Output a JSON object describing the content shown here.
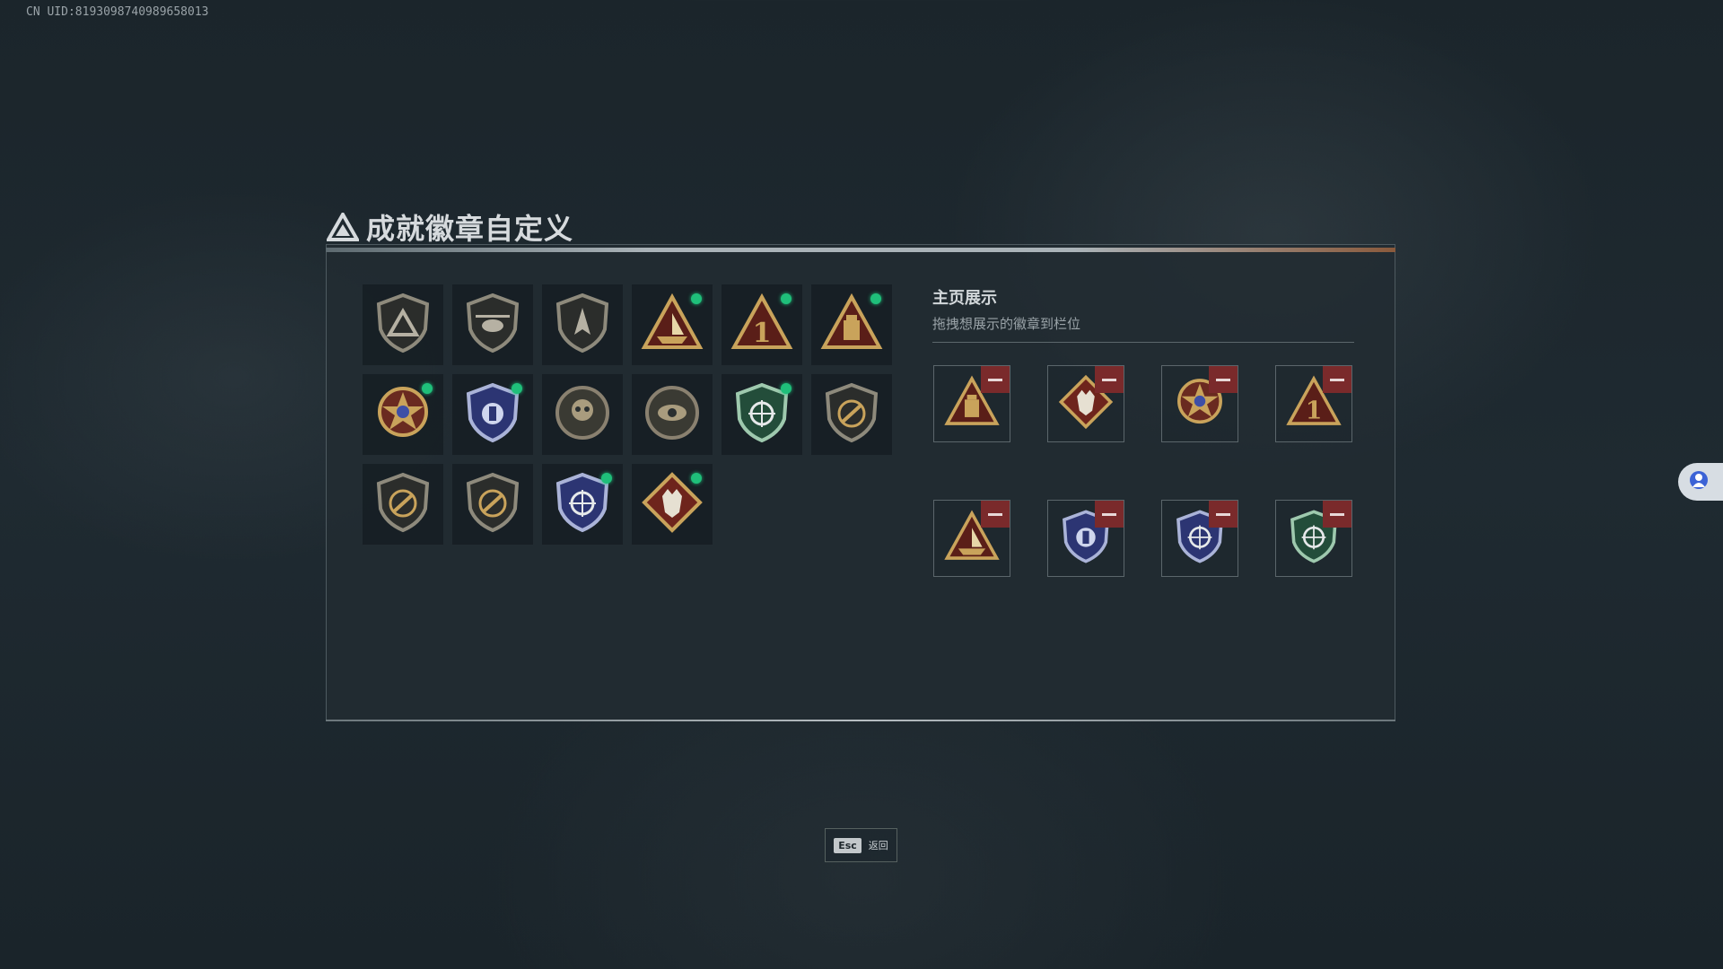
{
  "uid_label": "CN UID:8193098740989658013",
  "title": "成就徽章自定义",
  "badges": [
    {
      "icon": "delta-shield-badge-icon",
      "new": false
    },
    {
      "icon": "helicopter-badge-icon",
      "new": false
    },
    {
      "icon": "jet-shield-badge-icon",
      "new": false
    },
    {
      "icon": "boat-triangle-badge-icon",
      "new": true
    },
    {
      "icon": "number-one-triangle-badge-icon",
      "new": true
    },
    {
      "icon": "supply-box-triangle-badge-icon",
      "new": true
    },
    {
      "icon": "star-medal-badge-icon",
      "new": true
    },
    {
      "icon": "police-shield-badge-icon",
      "new": true
    },
    {
      "icon": "skull-gear-badge-icon",
      "new": false
    },
    {
      "icon": "eye-sunburst-badge-icon",
      "new": false
    },
    {
      "icon": "green-crosshair-shield-badge-icon",
      "new": true
    },
    {
      "icon": "rifle-shield-badge-icon",
      "new": false
    },
    {
      "icon": "rifle-shield-badge-icon",
      "new": false
    },
    {
      "icon": "rifle-shield-badge-icon",
      "new": false
    },
    {
      "icon": "blue-crosshair-shield-badge-icon",
      "new": true
    },
    {
      "icon": "wolf-diamond-badge-icon",
      "new": true
    }
  ],
  "showcase": {
    "title": "主页展示",
    "hint": "拖拽想展示的徽章到栏位",
    "slots": [
      {
        "icon": "supply-box-triangle-badge-icon"
      },
      {
        "icon": "wolf-diamond-badge-icon"
      },
      {
        "icon": "star-medal-badge-icon"
      },
      {
        "icon": "number-one-triangle-badge-icon"
      },
      {
        "icon": "boat-triangle-badge-icon"
      },
      {
        "icon": "police-shield-badge-icon"
      },
      {
        "icon": "blue-crosshair-shield-badge-icon"
      },
      {
        "icon": "green-crosshair-shield-badge-icon"
      }
    ]
  },
  "footer": {
    "esc_key": "Esc",
    "back_label": "返回"
  },
  "colors": {
    "new_dot": "#1fbf7a",
    "remove_button": "#7a2a2b",
    "gold": "#c9a35b"
  }
}
